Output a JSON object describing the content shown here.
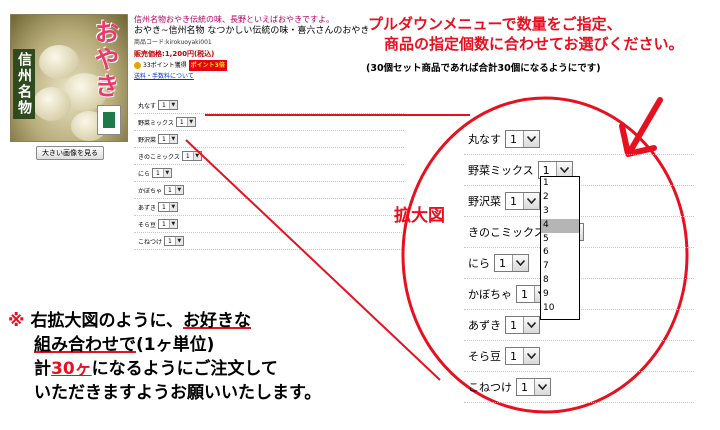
{
  "product": {
    "image_text_main": "おやき",
    "image_text_side": "信州名物",
    "big_image_button": "大きい画像を見る",
    "catch_copy": "信州名物おやき伝統の味、長野といえばおやきですよ。",
    "title": "おやき~信州名物 なつかしい伝統の味・喜六さんのおやき",
    "code": "商品コード:kirokuoyaki001",
    "price_label": "販売価格:",
    "price": "1,200円(税込)",
    "points": "33ポイント獲得",
    "bonus_badge": "ポイント3倍",
    "shipping_link": "送料・手数料について"
  },
  "flavors_small": [
    {
      "label": "丸なす",
      "value": "1"
    },
    {
      "label": "野菜ミックス",
      "value": "1"
    },
    {
      "label": "野沢菜",
      "value": "1"
    },
    {
      "label": "きのこミックス",
      "value": "1"
    },
    {
      "label": "にら",
      "value": "1"
    },
    {
      "label": "かぼちゃ",
      "value": "1"
    },
    {
      "label": "あずき",
      "value": "1"
    },
    {
      "label": "そら豆",
      "value": "1"
    },
    {
      "label": "こねつけ",
      "value": "1"
    }
  ],
  "flavors_zoom": [
    {
      "label": "丸なす",
      "value": "1"
    },
    {
      "label": "野菜ミックス",
      "value": "1"
    },
    {
      "label": "野沢菜",
      "value": "1"
    },
    {
      "label": "きのこミックス",
      "value": "1"
    },
    {
      "label": "にら",
      "value": "1"
    },
    {
      "label": "かぼちゃ",
      "value": "1"
    },
    {
      "label": "あずき",
      "value": "1"
    },
    {
      "label": "そら豆",
      "value": "1"
    },
    {
      "label": "こねつけ",
      "value": "1"
    }
  ],
  "dropdown": {
    "options": [
      "1",
      "2",
      "3",
      "4",
      "5",
      "6",
      "7",
      "8",
      "9",
      "10"
    ],
    "highlighted": "4"
  },
  "annotations": {
    "note_line1": "プルダウンメニューで数量をご指定、",
    "note_line2": "商品の指定個数に合わせてお選びください。",
    "note_line3": "(30個セット商品であれば合計30個になるようにです)",
    "zoom_label": "拡大図",
    "bottom_mark": "※",
    "bottom_line1_a": "右拡大図のように、",
    "bottom_line1_b": "お好きな",
    "bottom_line2_a": "組み合わせで",
    "bottom_line2_b": "(1ヶ単位)",
    "bottom_line3_a": "計",
    "bottom_line3_b": "30ヶ",
    "bottom_line3_c": "になるようにご注文して",
    "bottom_line4": "いただきますようお願いいたします。"
  },
  "colors": {
    "annotation_red": "#e8101f",
    "catch_pink": "#b5005b"
  }
}
